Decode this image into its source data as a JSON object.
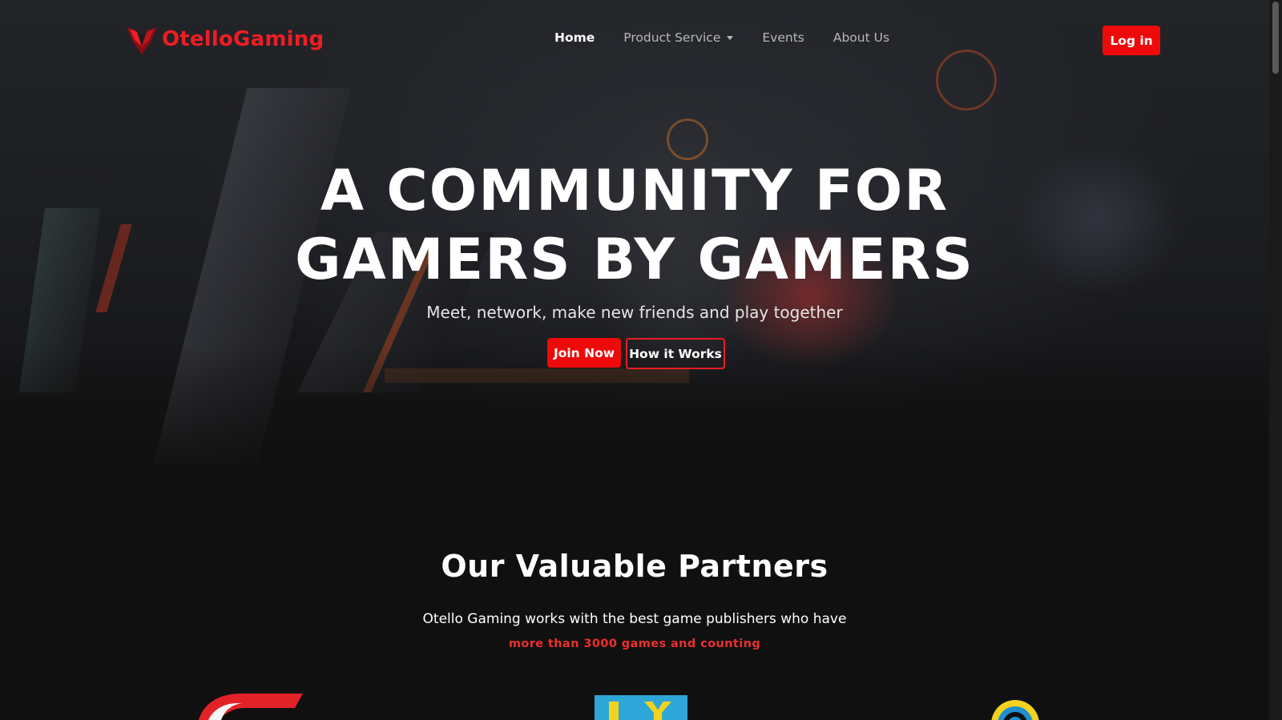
{
  "brand": {
    "name": "OtelloGaming",
    "color": "#ee1d24"
  },
  "nav": {
    "links": [
      {
        "label": "Home",
        "active": true
      },
      {
        "label": "Product Service",
        "dropdown": true
      },
      {
        "label": "Events"
      },
      {
        "label": "About Us"
      }
    ],
    "login_label": "Log in"
  },
  "hero": {
    "title_line1": "A COMMUNITY FOR",
    "title_line2": "GAMERS BY GAMERS",
    "subtitle": "Meet, network, make new friends and play together",
    "join_label": "Join Now",
    "how_label": "How it Works"
  },
  "partners": {
    "title": "Our Valuable Partners",
    "description": "Otello Gaming works with the best game publishers who have",
    "highlight": "more than 3000 games and counting"
  },
  "colors": {
    "accent": "#ee0a0a",
    "background": "#101010"
  }
}
